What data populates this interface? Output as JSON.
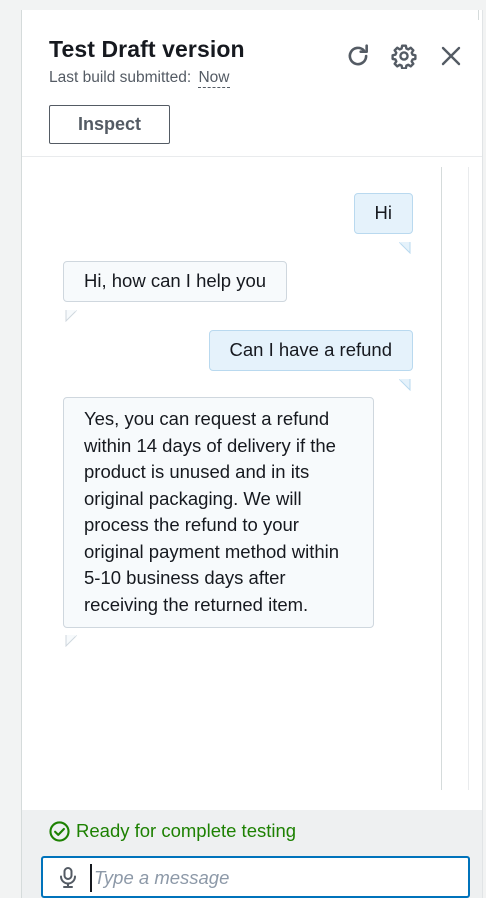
{
  "panel": {
    "title": "Test Draft version",
    "subtitle_label": "Last build submitted:",
    "subtitle_value": "Now",
    "inspect_label": "Inspect",
    "icons": [
      "refresh-icon",
      "gear-icon",
      "close-icon"
    ]
  },
  "messages": [
    {
      "role": "user",
      "text": "Hi"
    },
    {
      "role": "bot",
      "text": "Hi, how can I help you"
    },
    {
      "role": "user",
      "text": "Can I have a refund"
    },
    {
      "role": "bot",
      "text": "Yes, you can request a refund within 14 days of delivery if the product is unused and in its original packaging. We will process the refund to your original payment method within 5-10 business days after receiving the returned item."
    }
  ],
  "status": {
    "text": "Ready for complete testing",
    "color": "#1d8102",
    "icon": "check-circle-icon"
  },
  "input": {
    "placeholder": "Type a message",
    "value": "",
    "icon": "microphone-icon"
  },
  "colors": {
    "accent": "#0073bb",
    "user_bubble": "#e5f2fb",
    "bot_bubble": "#f7fafc"
  }
}
